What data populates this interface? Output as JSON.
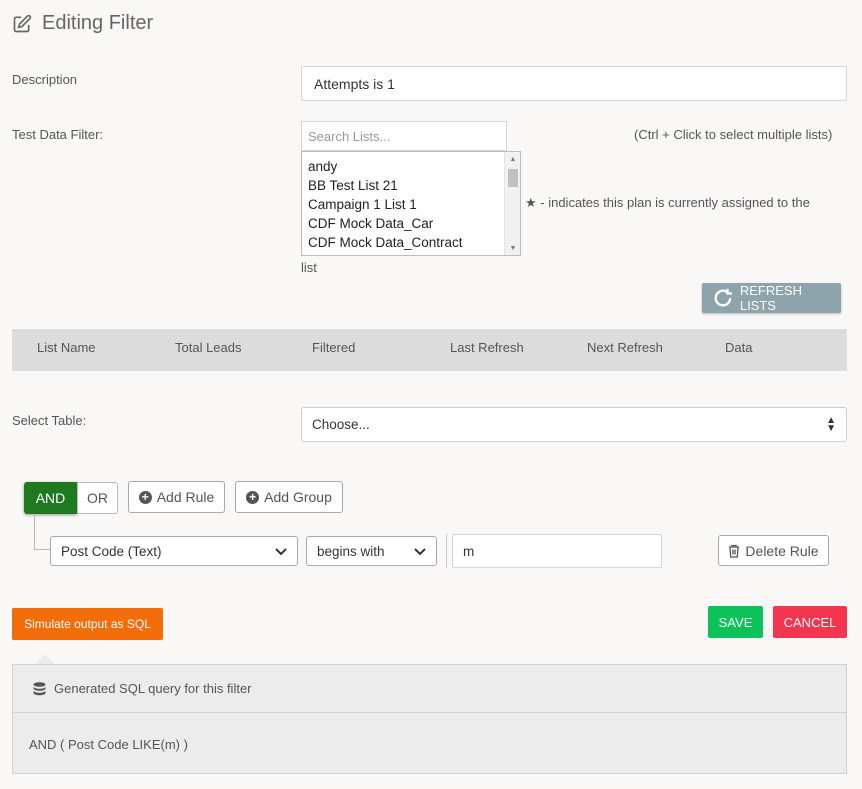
{
  "header": {
    "title": "Editing Filter",
    "icon": "edit-icon"
  },
  "form": {
    "description_label": "Description",
    "description_value": "Attempts is 1",
    "test_data_label": "Test Data Filter:",
    "search_placeholder": "Search Lists...",
    "hint_multi": "(Ctrl + Click to select multiple lists)",
    "hint_star": "★ - indicates this plan is currently assigned to the",
    "hint_star_cont": "list",
    "lists": [
      "andy",
      "BB Test List 21",
      "Campaign 1 List 1",
      "CDF Mock Data_Car",
      "CDF Mock Data_Contract"
    ],
    "refresh_label": "REFRESH LISTS",
    "select_table_label": "Select Table:",
    "select_table_value": "Choose..."
  },
  "table": {
    "columns": [
      "List Name",
      "Total Leads",
      "Filtered",
      "Last Refresh",
      "Next Refresh",
      "Data"
    ]
  },
  "builder": {
    "and_label": "AND",
    "or_label": "OR",
    "add_rule_label": "Add Rule",
    "add_group_label": "Add Group",
    "rule": {
      "field": "Post Code (Text)",
      "operator": "begins with",
      "value": "m",
      "delete_label": "Delete Rule"
    }
  },
  "actions": {
    "simulate_label": "Simulate output as SQL",
    "save_label": "SAVE",
    "cancel_label": "CANCEL"
  },
  "sql": {
    "heading": "Generated SQL query for this filter",
    "query": "AND ( Post Code LIKE(m) )"
  },
  "colors": {
    "and_green": "#1e7a1e",
    "simulate_orange": "#f36e0a",
    "save_green": "#0ec25a",
    "cancel_red": "#f4354f",
    "refresh_gray": "#8ea4ad"
  }
}
